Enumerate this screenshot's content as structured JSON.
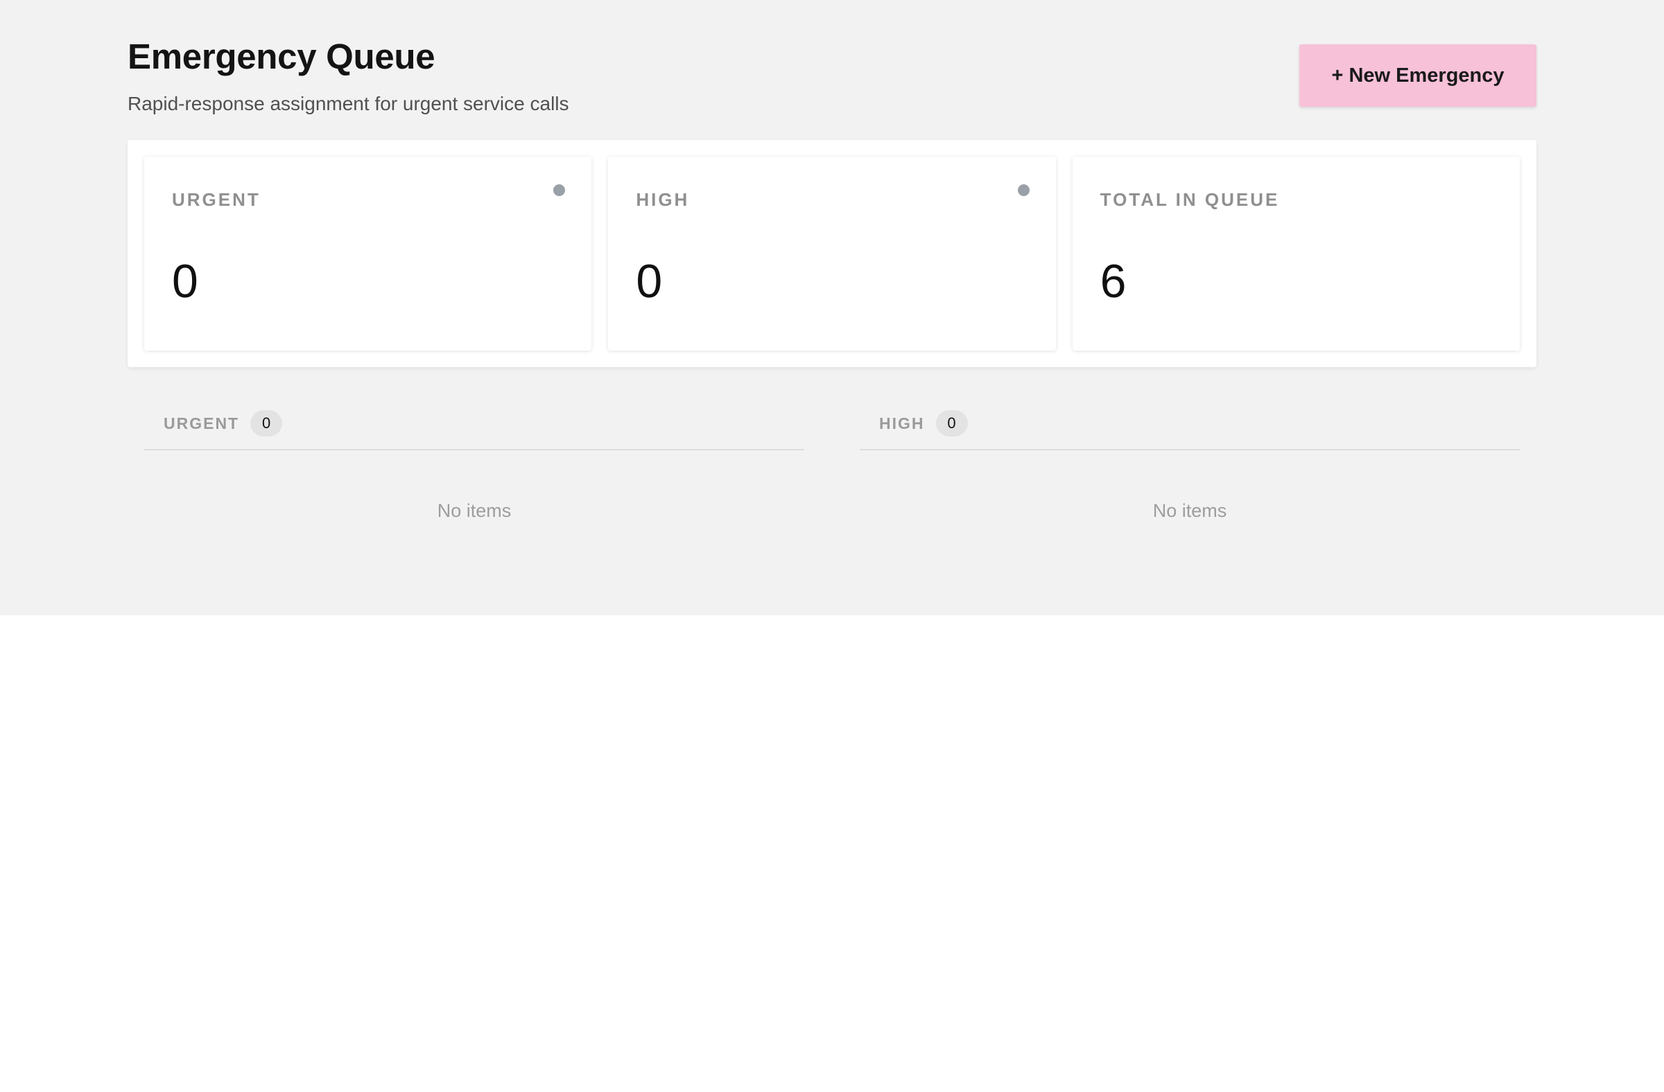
{
  "header": {
    "title": "Emergency Queue",
    "subtitle": "Rapid-response assignment for urgent service calls",
    "new_button_label": "+ New Emergency"
  },
  "stats": [
    {
      "label": "URGENT",
      "value": "0",
      "has_dot": true
    },
    {
      "label": "HIGH",
      "value": "0",
      "has_dot": true
    },
    {
      "label": "TOTAL IN QUEUE",
      "value": "6",
      "has_dot": false
    }
  ],
  "columns": [
    {
      "title": "URGENT",
      "count": "0",
      "empty_text": "No items"
    },
    {
      "title": "HIGH",
      "count": "0",
      "empty_text": "No items"
    }
  ],
  "colors": {
    "accent_button": "#f7c1d8",
    "page_background": "#f2f2f2",
    "status_dot": "#9aa0a8"
  }
}
